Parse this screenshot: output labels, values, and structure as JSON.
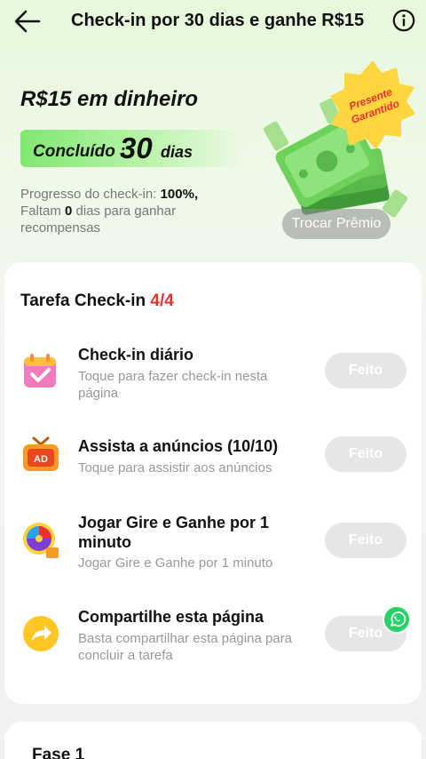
{
  "header": {
    "title": "Check-in por 30 dias e ganhe R$15",
    "back_icon": "arrow-left-icon",
    "info_icon": "info-circle-icon"
  },
  "hero": {
    "reward_title": "R$15 em dinheiro",
    "completed_label": "Concluído :",
    "completed_days": "30",
    "completed_unit": "dias",
    "progress_label": "Progresso do check-in:",
    "progress_value": "100%,",
    "remaining_prefix": "Faltam",
    "remaining_days": "0",
    "remaining_suffix": "dias para ganhar recompensas",
    "badge_line1": "Presente",
    "badge_line2": "Garantido",
    "exchange_button": "Trocar Prêmio"
  },
  "tasks": {
    "title": "Tarefa Check-in",
    "count": "4/4",
    "items": [
      {
        "name": "Check-in diário",
        "desc": "Toque para fazer check-in nesta página",
        "button": "Feito",
        "icon": "calendar-check-icon"
      },
      {
        "name": "Assista a anúncios  (10/10)",
        "desc": "Toque para assistir aos anúncios",
        "button": "Feito",
        "icon": "ad-tv-icon"
      },
      {
        "name": "Jogar Gire e Ganhe por 1 minuto",
        "desc": "Jogar Gire e Ganhe por 1 minuto",
        "button": "Feito",
        "icon": "spin-wheel-icon"
      },
      {
        "name": "Compartilhe esta página",
        "desc": "Basta compartilhar esta página para concluir a tarefa",
        "button": "Feito",
        "icon": "share-arrow-icon"
      }
    ]
  },
  "phase": {
    "title": "Fase 1"
  },
  "colors": {
    "accent_green": "#7fe870",
    "count_red": "#e8312c",
    "done_gray": "#e6e6e6",
    "whatsapp": "#25d366"
  }
}
